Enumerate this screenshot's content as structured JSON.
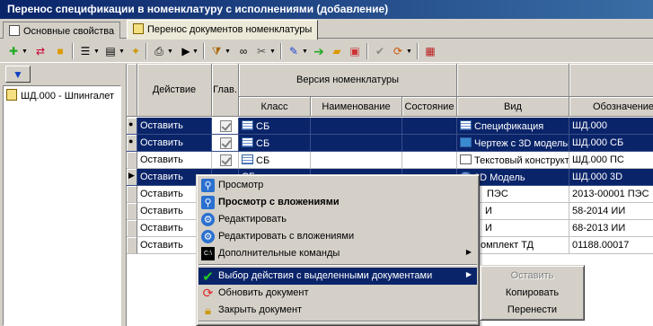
{
  "window": {
    "title": "Перенос спецификации в номенклатуру с исполнениями (добавление)"
  },
  "tabs": [
    {
      "label": "Основные свойства",
      "active": false
    },
    {
      "label": "Перенос документов номенклатуры",
      "active": true
    }
  ],
  "toolbar": {
    "icons": [
      "add-icon",
      "move-icon",
      "folder-icon",
      "list-icon",
      "doc-icon",
      "wand-icon",
      "print-icon",
      "play-icon",
      "filter-icon",
      "binoculars-icon",
      "tools-icon",
      "link-icon",
      "arrow-right-icon",
      "folder-open-icon",
      "window-icon",
      "check-icon",
      "refresh-icon",
      "table-icon"
    ]
  },
  "left_panel": {
    "filter_button_glyph": "▼",
    "tree": [
      {
        "label": "ШД.000 - Шпингалет"
      }
    ]
  },
  "grid": {
    "headers": {
      "action": "Действие",
      "main": "Глав.",
      "version_group": "Версия номенклатуры",
      "class": "Класс",
      "name": "Наименование",
      "state": "Состояние",
      "type": "Вид",
      "designation": "Обозначение"
    },
    "rows": [
      {
        "marker": "●",
        "action": "Оставить",
        "main": true,
        "class": "СБ",
        "type": "Спецификация",
        "type_icon": "spec",
        "designation": "ШД.000",
        "selected": true
      },
      {
        "marker": "●",
        "action": "Оставить",
        "main": true,
        "class": "СБ",
        "type": "Чертеж с 3D моделью",
        "type_icon": "c3d",
        "designation": "ШД.000 СБ",
        "selected": true
      },
      {
        "marker": "",
        "action": "Оставить",
        "main": true,
        "class": "СБ",
        "type": "Текстовый конструкт",
        "type_icon": "txt",
        "designation": "ШД.000 ПС",
        "selected": false
      },
      {
        "marker": "▶",
        "action": "Оставить",
        "main": false,
        "class": "СБ",
        "type": "3D Модель",
        "type_icon": "model",
        "designation": "ШД.000 3D",
        "selected": true
      },
      {
        "marker": "",
        "action": "Оставить",
        "main": false,
        "class": "",
        "type": "ПЭС",
        "type_icon": "",
        "designation": "2013-00001 ПЭС",
        "selected": false
      },
      {
        "marker": "",
        "action": "Оставить",
        "main": false,
        "class": "",
        "type": "И",
        "type_icon": "",
        "designation": "58-2014 ИИ",
        "selected": false
      },
      {
        "marker": "",
        "action": "Оставить",
        "main": false,
        "class": "",
        "type": "И",
        "type_icon": "",
        "designation": "68-2013 ИИ",
        "selected": false
      },
      {
        "marker": "",
        "action": "Оставить",
        "main": false,
        "class": "",
        "type": "омплект ТД",
        "type_icon": "",
        "designation": "01188.00017",
        "selected": false
      }
    ]
  },
  "context_menu": {
    "items": [
      {
        "label": "Просмотр",
        "icon": "magnifier-icon",
        "bold": false
      },
      {
        "label": "Просмотр с вложениями",
        "icon": "magnifier-attach-icon",
        "bold": true
      },
      {
        "label": "Редактировать",
        "icon": "gear-icon",
        "bold": false
      },
      {
        "label": "Редактировать с вложениями",
        "icon": "gear-attach-icon",
        "bold": false
      },
      {
        "label": "Дополнительные команды",
        "icon": "console-icon",
        "bold": false,
        "submenu": true
      },
      {
        "label": "Выбор действия с выделенными документами",
        "icon": "checkmark-icon",
        "bold": false,
        "submenu": true,
        "highlighted": true
      },
      {
        "label": "Обновить документ",
        "icon": "refresh-icon",
        "bold": false
      },
      {
        "label": "Закрыть документ",
        "icon": "lock-icon",
        "bold": false
      }
    ]
  },
  "submenu": {
    "items": [
      {
        "label": "Оставить",
        "disabled": true
      },
      {
        "label": "Копировать",
        "disabled": false
      },
      {
        "label": "Перенести",
        "disabled": false
      }
    ]
  }
}
